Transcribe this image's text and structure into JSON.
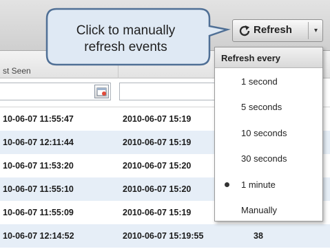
{
  "toolbar": {
    "refresh_label": "Refresh",
    "dropdown_glyph": "▾"
  },
  "column_header": {
    "title_partial": "st Seen"
  },
  "rows": [
    {
      "first_seen": "10-06-07 11:55:47",
      "last_seen": "2010-06-07 15:19",
      "count": ""
    },
    {
      "first_seen": "10-06-07 12:11:44",
      "last_seen": "2010-06-07 15:19",
      "count": ""
    },
    {
      "first_seen": "10-06-07 11:53:20",
      "last_seen": "2010-06-07 15:20",
      "count": ""
    },
    {
      "first_seen": "10-06-07 11:55:10",
      "last_seen": "2010-06-07 15:20",
      "count": ""
    },
    {
      "first_seen": "10-06-07 11:55:09",
      "last_seen": "2010-06-07 15:19",
      "count": ""
    },
    {
      "first_seen": "10-06-07 12:14:52",
      "last_seen": "2010-06-07 15:19:55",
      "count": "38"
    }
  ],
  "menu": {
    "header": "Refresh every",
    "items": [
      {
        "label": "1 second",
        "selected": false
      },
      {
        "label": "5 seconds",
        "selected": false
      },
      {
        "label": "10 seconds",
        "selected": false
      },
      {
        "label": "30 seconds",
        "selected": false
      },
      {
        "label": "1 minute",
        "selected": true
      },
      {
        "label": "Manually",
        "selected": false
      }
    ]
  },
  "callout": {
    "line1": "Click to manually",
    "line2": "refresh events"
  },
  "colors": {
    "alt_row": "#e6eef7",
    "callout_fill": "#dfe9f4",
    "callout_border": "#4f6f95"
  },
  "icons": {
    "refresh": "refresh-icon",
    "filter": "filter-icon",
    "selected": "radio-dot-icon"
  }
}
